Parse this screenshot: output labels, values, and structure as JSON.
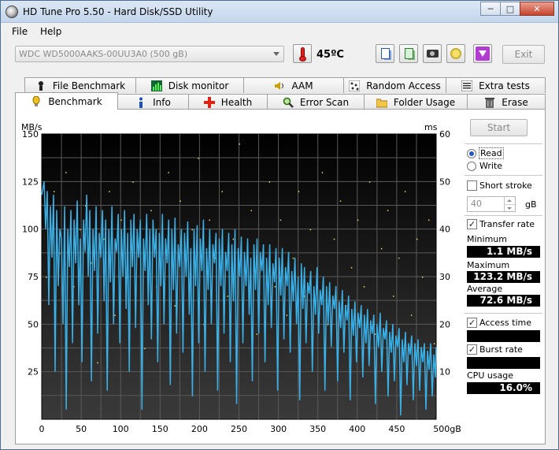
{
  "window": {
    "title": "HD Tune Pro 5.50 - Hard Disk/SSD Utility",
    "minimize": "─",
    "maximize": "□",
    "close": "✕"
  },
  "menu": [
    {
      "label": "File"
    },
    {
      "label": "Help"
    }
  ],
  "toolbar": {
    "drive": "WDC WD5000AAKS-00UU3A0 (500 gB)",
    "temperature": "45ºC",
    "exit_label": "Exit"
  },
  "tabs_top": [
    {
      "label": "File Benchmark",
      "icon": "file-benchmark-icon"
    },
    {
      "label": "Disk monitor",
      "icon": "disk-monitor-icon"
    },
    {
      "label": "AAM",
      "icon": "speaker-icon"
    },
    {
      "label": "Random Access",
      "icon": "random-access-icon"
    },
    {
      "label": "Extra tests",
      "icon": "extra-tests-icon"
    }
  ],
  "tabs_bottom": [
    {
      "label": "Benchmark",
      "icon": "benchmark-icon"
    },
    {
      "label": "Info",
      "icon": "info-icon"
    },
    {
      "label": "Health",
      "icon": "health-icon"
    },
    {
      "label": "Error Scan",
      "icon": "magnifier-icon"
    },
    {
      "label": "Folder Usage",
      "icon": "folder-icon"
    },
    {
      "label": "Erase",
      "icon": "trash-icon"
    }
  ],
  "controls": {
    "start_label": "Start",
    "read_label": "Read",
    "write_label": "Write",
    "short_stroke_label": "Short stroke",
    "short_stroke_value": "40",
    "short_stroke_unit": "gB",
    "transfer_rate_label": "Transfer rate",
    "minimum_label": "Minimum",
    "minimum_value": "1.1 MB/s",
    "maximum_label": "Maximum",
    "maximum_value": "123.2 MB/s",
    "average_label": "Average",
    "average_value": "72.6 MB/s",
    "access_time_label": "Access time",
    "burst_rate_label": "Burst rate",
    "cpu_usage_label": "CPU usage",
    "cpu_usage_value": "16.0%"
  },
  "chart_data": {
    "type": "line",
    "ylabel": "MB/s",
    "y2label": "ms",
    "xunit": "gB",
    "xlim": [
      0,
      500
    ],
    "ylim": [
      0,
      150
    ],
    "y2lim": [
      0,
      60
    ],
    "x_ticks": [
      0,
      50,
      100,
      150,
      200,
      250,
      300,
      350,
      400,
      450,
      500
    ],
    "y_ticks": [
      25,
      50,
      75,
      100,
      125,
      150
    ],
    "y2_ticks": [
      10,
      20,
      30,
      40,
      50,
      60
    ],
    "grid": true,
    "colors": {
      "background": "#1a1a1a",
      "grid": "#5a5a5a",
      "transfer": "#3bb0e6",
      "access": "#e6e060"
    },
    "transfer_series": [
      [
        0,
        118
      ],
      [
        3,
        125
      ],
      [
        5,
        100
      ],
      [
        7,
        120
      ],
      [
        9,
        60
      ],
      [
        11,
        112
      ],
      [
        13,
        85
      ],
      [
        15,
        118
      ],
      [
        17,
        25
      ],
      [
        19,
        110
      ],
      [
        21,
        70
      ],
      [
        23,
        100
      ],
      [
        25,
        95
      ],
      [
        27,
        50
      ],
      [
        29,
        112
      ],
      [
        31,
        5
      ],
      [
        33,
        100
      ],
      [
        35,
        80
      ],
      [
        37,
        110
      ],
      [
        39,
        40
      ],
      [
        41,
        105
      ],
      [
        43,
        82
      ],
      [
        45,
        115
      ],
      [
        47,
        60
      ],
      [
        49,
        95
      ],
      [
        51,
        30
      ],
      [
        53,
        105
      ],
      [
        55,
        88
      ],
      [
        57,
        118
      ],
      [
        59,
        75
      ],
      [
        61,
        110
      ],
      [
        63,
        20
      ],
      [
        65,
        100
      ],
      [
        67,
        78
      ],
      [
        69,
        112
      ],
      [
        71,
        45
      ],
      [
        73,
        98
      ],
      [
        75,
        85
      ],
      [
        77,
        110
      ],
      [
        79,
        62
      ],
      [
        81,
        105
      ],
      [
        83,
        15
      ],
      [
        85,
        100
      ],
      [
        87,
        72
      ],
      [
        89,
        112
      ],
      [
        91,
        50
      ],
      [
        93,
        95
      ],
      [
        95,
        88
      ],
      [
        97,
        108
      ],
      [
        99,
        40
      ],
      [
        101,
        100
      ],
      [
        103,
        75
      ],
      [
        105,
        110
      ],
      [
        107,
        58
      ],
      [
        109,
        98
      ],
      [
        111,
        25
      ],
      [
        113,
        105
      ],
      [
        115,
        80
      ],
      [
        117,
        108
      ],
      [
        119,
        48
      ],
      [
        121,
        100
      ],
      [
        123,
        85
      ],
      [
        125,
        105
      ],
      [
        127,
        5
      ],
      [
        129,
        95
      ],
      [
        131,
        78
      ],
      [
        133,
        108
      ],
      [
        135,
        60
      ],
      [
        137,
        100
      ],
      [
        139,
        42
      ],
      [
        141,
        105
      ],
      [
        143,
        85
      ],
      [
        145,
        100
      ],
      [
        147,
        30
      ],
      [
        149,
        98
      ],
      [
        151,
        70
      ],
      [
        153,
        108
      ],
      [
        155,
        50
      ],
      [
        157,
        95
      ],
      [
        159,
        82
      ],
      [
        161,
        105
      ],
      [
        163,
        18
      ],
      [
        165,
        100
      ],
      [
        167,
        68
      ],
      [
        169,
        106
      ],
      [
        171,
        45
      ],
      [
        173,
        92
      ],
      [
        175,
        80
      ],
      [
        177,
        100
      ],
      [
        179,
        35
      ],
      [
        181,
        98
      ],
      [
        183,
        75
      ],
      [
        185,
        104
      ],
      [
        187,
        55
      ],
      [
        189,
        90
      ],
      [
        191,
        12
      ],
      [
        193,
        100
      ],
      [
        195,
        70
      ],
      [
        197,
        102
      ],
      [
        199,
        40
      ],
      [
        201,
        95
      ],
      [
        203,
        78
      ],
      [
        205,
        105
      ],
      [
        207,
        25
      ],
      [
        209,
        90
      ],
      [
        211,
        68
      ],
      [
        213,
        100
      ],
      [
        215,
        50
      ],
      [
        217,
        92
      ],
      [
        219,
        82
      ],
      [
        221,
        98
      ],
      [
        223,
        15
      ],
      [
        225,
        95
      ],
      [
        227,
        70
      ],
      [
        229,
        100
      ],
      [
        231,
        45
      ],
      [
        233,
        88
      ],
      [
        235,
        78
      ],
      [
        237,
        98
      ],
      [
        239,
        30
      ],
      [
        241,
        92
      ],
      [
        243,
        62
      ],
      [
        245,
        100
      ],
      [
        247,
        8
      ],
      [
        249,
        90
      ],
      [
        251,
        75
      ],
      [
        253,
        96
      ],
      [
        255,
        40
      ],
      [
        257,
        88
      ],
      [
        259,
        70
      ],
      [
        261,
        95
      ],
      [
        263,
        55
      ],
      [
        265,
        85
      ],
      [
        267,
        20
      ],
      [
        269,
        92
      ],
      [
        271,
        68
      ],
      [
        273,
        95
      ],
      [
        275,
        45
      ],
      [
        277,
        88
      ],
      [
        279,
        78
      ],
      [
        281,
        92
      ],
      [
        283,
        30
      ],
      [
        285,
        85
      ],
      [
        287,
        60
      ],
      [
        289,
        92
      ],
      [
        291,
        48
      ],
      [
        293,
        82
      ],
      [
        295,
        72
      ],
      [
        297,
        90
      ],
      [
        299,
        15
      ],
      [
        301,
        85
      ],
      [
        303,
        65
      ],
      [
        305,
        90
      ],
      [
        307,
        42
      ],
      [
        309,
        80
      ],
      [
        311,
        70
      ],
      [
        313,
        88
      ],
      [
        315,
        35
      ],
      [
        317,
        78
      ],
      [
        319,
        62
      ],
      [
        321,
        85
      ],
      [
        323,
        50
      ],
      [
        325,
        75
      ],
      [
        327,
        10
      ],
      [
        329,
        82
      ],
      [
        331,
        58
      ],
      [
        333,
        80
      ],
      [
        335,
        40
      ],
      [
        337,
        72
      ],
      [
        339,
        66
      ],
      [
        341,
        78
      ],
      [
        343,
        25
      ],
      [
        345,
        70
      ],
      [
        347,
        55
      ],
      [
        349,
        80
      ],
      [
        351,
        45
      ],
      [
        353,
        68
      ],
      [
        355,
        60
      ],
      [
        357,
        75
      ],
      [
        359,
        15
      ],
      [
        361,
        70
      ],
      [
        363,
        50
      ],
      [
        365,
        72
      ],
      [
        367,
        38
      ],
      [
        369,
        65
      ],
      [
        371,
        58
      ],
      [
        373,
        70
      ],
      [
        375,
        20
      ],
      [
        377,
        62
      ],
      [
        379,
        48
      ],
      [
        381,
        68
      ],
      [
        383,
        35
      ],
      [
        385,
        60
      ],
      [
        387,
        52
      ],
      [
        389,
        65
      ],
      [
        391,
        10
      ],
      [
        393,
        58
      ],
      [
        395,
        44
      ],
      [
        397,
        62
      ],
      [
        399,
        30
      ],
      [
        401,
        56
      ],
      [
        403,
        48
      ],
      [
        405,
        60
      ],
      [
        407,
        22
      ],
      [
        409,
        55
      ],
      [
        411,
        40
      ],
      [
        413,
        58
      ],
      [
        415,
        28
      ],
      [
        417,
        52
      ],
      [
        419,
        45
      ],
      [
        421,
        55
      ],
      [
        423,
        8
      ],
      [
        425,
        50
      ],
      [
        427,
        38
      ],
      [
        429,
        56
      ],
      [
        431,
        25
      ],
      [
        433,
        48
      ],
      [
        435,
        42
      ],
      [
        437,
        52
      ],
      [
        439,
        12
      ],
      [
        441,
        46
      ],
      [
        443,
        35
      ],
      [
        445,
        50
      ],
      [
        447,
        20
      ],
      [
        449,
        44
      ],
      [
        451,
        38
      ],
      [
        453,
        48
      ],
      [
        455,
        2
      ],
      [
        457,
        42
      ],
      [
        459,
        30
      ],
      [
        461,
        46
      ],
      [
        463,
        18
      ],
      [
        465,
        40
      ],
      [
        467,
        34
      ],
      [
        469,
        44
      ],
      [
        471,
        10
      ],
      [
        473,
        40
      ],
      [
        475,
        28
      ],
      [
        477,
        42
      ],
      [
        479,
        15
      ],
      [
        481,
        38
      ],
      [
        483,
        30
      ],
      [
        485,
        40
      ],
      [
        487,
        5
      ],
      [
        489,
        36
      ],
      [
        491,
        26
      ],
      [
        493,
        40
      ],
      [
        495,
        12
      ],
      [
        497,
        34
      ],
      [
        499,
        22
      ],
      [
        500,
        38
      ]
    ],
    "access_points": [
      [
        5,
        30
      ],
      [
        15,
        48
      ],
      [
        22,
        35
      ],
      [
        30,
        52
      ],
      [
        40,
        28
      ],
      [
        48,
        40
      ],
      [
        55,
        45
      ],
      [
        62,
        33
      ],
      [
        70,
        12
      ],
      [
        78,
        38
      ],
      [
        85,
        48
      ],
      [
        92,
        22
      ],
      [
        100,
        42
      ],
      [
        108,
        30
      ],
      [
        115,
        50
      ],
      [
        122,
        36
      ],
      [
        130,
        15
      ],
      [
        138,
        44
      ],
      [
        145,
        28
      ],
      [
        152,
        38
      ],
      [
        160,
        52
      ],
      [
        168,
        24
      ],
      [
        175,
        46
      ],
      [
        182,
        32
      ],
      [
        190,
        40
      ],
      [
        198,
        55
      ],
      [
        205,
        20
      ],
      [
        212,
        42
      ],
      [
        220,
        34
      ],
      [
        228,
        48
      ],
      [
        235,
        26
      ],
      [
        242,
        38
      ],
      [
        250,
        58
      ],
      [
        258,
        30
      ],
      [
        265,
        44
      ],
      [
        272,
        18
      ],
      [
        280,
        36
      ],
      [
        288,
        50
      ],
      [
        295,
        28
      ],
      [
        302,
        42
      ],
      [
        310,
        22
      ],
      [
        318,
        34
      ],
      [
        325,
        48
      ],
      [
        332,
        26
      ],
      [
        340,
        40
      ],
      [
        348,
        30
      ],
      [
        355,
        52
      ],
      [
        362,
        20
      ],
      [
        370,
        38
      ],
      [
        378,
        46
      ],
      [
        385,
        24
      ],
      [
        392,
        32
      ],
      [
        400,
        42
      ],
      [
        408,
        28
      ],
      [
        415,
        50
      ],
      [
        422,
        18
      ],
      [
        430,
        36
      ],
      [
        438,
        44
      ],
      [
        445,
        26
      ],
      [
        452,
        34
      ],
      [
        460,
        48
      ],
      [
        468,
        22
      ],
      [
        475,
        38
      ],
      [
        482,
        30
      ],
      [
        490,
        42
      ],
      [
        497,
        16
      ]
    ]
  }
}
